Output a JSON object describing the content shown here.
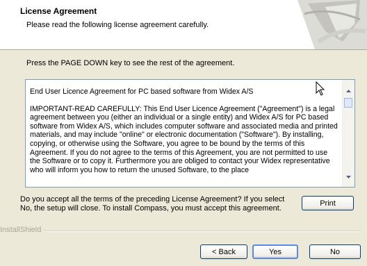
{
  "header": {
    "title": "License Agreement",
    "subtitle": "Please read the following license agreement carefully."
  },
  "instruction": "Press the PAGE DOWN key to see the rest of the agreement.",
  "license": {
    "heading": "End User Licence Agreement for PC based software from Widex A/S",
    "body": "IMPORTANT-READ CAREFULLY: This End User Licence Agreement (\"Agreement\") is a legal agreement between you (either an individual or a single entity) and Widex A/S for PC based software from Widex A/S, which includes computer software and associated media and printed materials, and may include \"online\" or electronic documentation (\"Software\"). By installing, copying, or otherwise using the Software, you agree to be bound by the terms of this Agreement. If you do not agree to the terms of this Agreement, you are not permitted to use the Software or to copy it. Furthermore you are obliged to contact your Widex representative who will inform you how to return the unused Software, to the place"
  },
  "question": "Do you accept all the terms of the preceding License Agreement?  If you select No,  the setup will close.  To install Compass, you must accept this agreement.",
  "installshield_label": "InstallShield",
  "buttons": {
    "print": "Print",
    "back": "< Back",
    "yes": "Yes",
    "no": "No"
  },
  "icons": {
    "header_graphic": "installer-banner-graphic",
    "scroll_up": "scroll-up-arrow-icon",
    "scroll_down": "scroll-down-arrow-icon",
    "cursor": "mouse-pointer-icon"
  },
  "colors": {
    "dialog_background": "#ece9d8",
    "button_border": "#003c74",
    "default_button_highlight": "#5a8ae6"
  }
}
